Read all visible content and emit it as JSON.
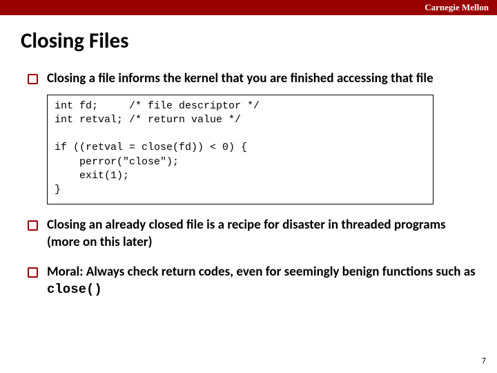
{
  "header": {
    "brand": "Carnegie Mellon"
  },
  "title": "Closing Files",
  "bullets": {
    "b1": "Closing a file informs the kernel that you are finished accessing that file",
    "b2": "Closing an already closed file is a recipe for disaster in threaded programs (more on this later)",
    "b3_prefix": "Moral: Always check return codes, even for seemingly benign functions such as ",
    "b3_code": "close()"
  },
  "code": "int fd;     /* file descriptor */\nint retval; /* return value */\n\nif ((retval = close(fd)) < 0) {\n    perror(\"close\");\n    exit(1);\n}",
  "page_number": "7"
}
